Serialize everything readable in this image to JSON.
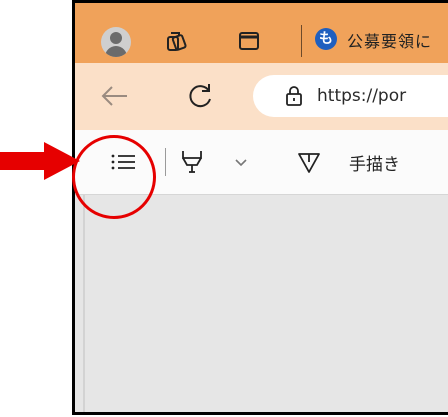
{
  "colors": {
    "tab_bar": "#f0a25a",
    "nav_bar": "#fbe0c8",
    "toolbar": "#fbfbfb",
    "content": "#e6e6e6",
    "highlight": "#e60000"
  },
  "tab": {
    "favicon_letter": "も",
    "title": "公募要領に"
  },
  "address_bar": {
    "url": "https://por"
  },
  "pdf_toolbar": {
    "draw_label": "手描き"
  },
  "annotation": {
    "arrow_color": "#e60000",
    "circle_target": "contents-list-button"
  },
  "icons": {
    "profile": "avatar-icon",
    "workspaces": "workspaces-icon",
    "tab_actions": "tab-actions-icon",
    "back": "back-arrow-icon",
    "refresh": "refresh-icon",
    "lock": "lock-icon",
    "contents": "list-icon",
    "highlight": "highlighter-icon",
    "chevron": "chevron-down-icon",
    "draw": "pen-icon"
  }
}
